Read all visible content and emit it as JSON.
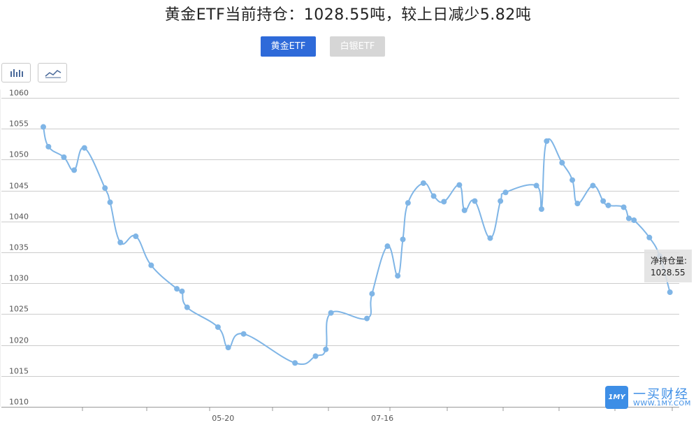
{
  "page": {
    "title": "黄金ETF当前持仓：1028.55吨，较上日减少5.82吨",
    "tabs": [
      {
        "label": "黄金ETF",
        "active": true
      },
      {
        "label": "白银ETF",
        "active": false
      }
    ],
    "toolbar": {
      "bar_icon": "bar-chart-icon",
      "line_icon": "line-chart-icon"
    },
    "tooltip": {
      "label": "净持仓量:",
      "value": "1028.55"
    },
    "watermark": {
      "logo": "1MY",
      "cn": "一买财经",
      "en": "WWW.1MY.COM"
    },
    "colors": {
      "line": "#7fb5e6",
      "grid": "#cccccc",
      "tab_active": "#2e6ad9",
      "tab_inactive": "#d6d6d6"
    }
  },
  "chart_data": {
    "type": "line",
    "title": "黄金ETF当前持仓：1028.55吨，较上日减少5.82吨",
    "xlabel": "",
    "ylabel": "",
    "ylim": [
      1010,
      1060
    ],
    "yticks": [
      1060,
      1055,
      1050,
      1045,
      1040,
      1035,
      1030,
      1025,
      1020,
      1015,
      1010
    ],
    "x_tick_labels": [
      {
        "label": "05-20",
        "index": 35
      },
      {
        "label": "07-16",
        "index": 66
      }
    ],
    "grid": true,
    "series": [
      {
        "values": [
          1055.3,
          1052.1,
          1050.4,
          1048.3,
          1051.9,
          1045.4,
          1043.1,
          1036.6,
          1037.6,
          1032.9,
          1029.1,
          1028.7,
          1026.1,
          1022.9,
          1019.6,
          1021.8,
          1017.1,
          1018.2,
          1019.3,
          1025.2,
          1024.3,
          1028.3,
          1036.0,
          1031.2,
          1037.1,
          1043.0,
          1046.2,
          1044.1,
          1043.2,
          1045.9,
          1041.8,
          1043.3,
          1037.3,
          1043.3,
          1044.7,
          1045.8,
          1042.0,
          1053.0,
          1049.5,
          1046.7,
          1042.9,
          1045.8,
          1043.3,
          1042.6,
          1042.3,
          1040.5,
          1040.2,
          1037.4,
          1034.4,
          1028.55
        ],
        "x_index": [
          0,
          1,
          4,
          6,
          8,
          12,
          13,
          15,
          18,
          21,
          26,
          27,
          28,
          34,
          36,
          39,
          49,
          53,
          55,
          56,
          63,
          64,
          67,
          69,
          70,
          71,
          74,
          76,
          78,
          81,
          82,
          84,
          87,
          89,
          90,
          96,
          97,
          98,
          101,
          103,
          104,
          107,
          109,
          110,
          113,
          114,
          115,
          118,
          120,
          122
        ]
      }
    ]
  }
}
